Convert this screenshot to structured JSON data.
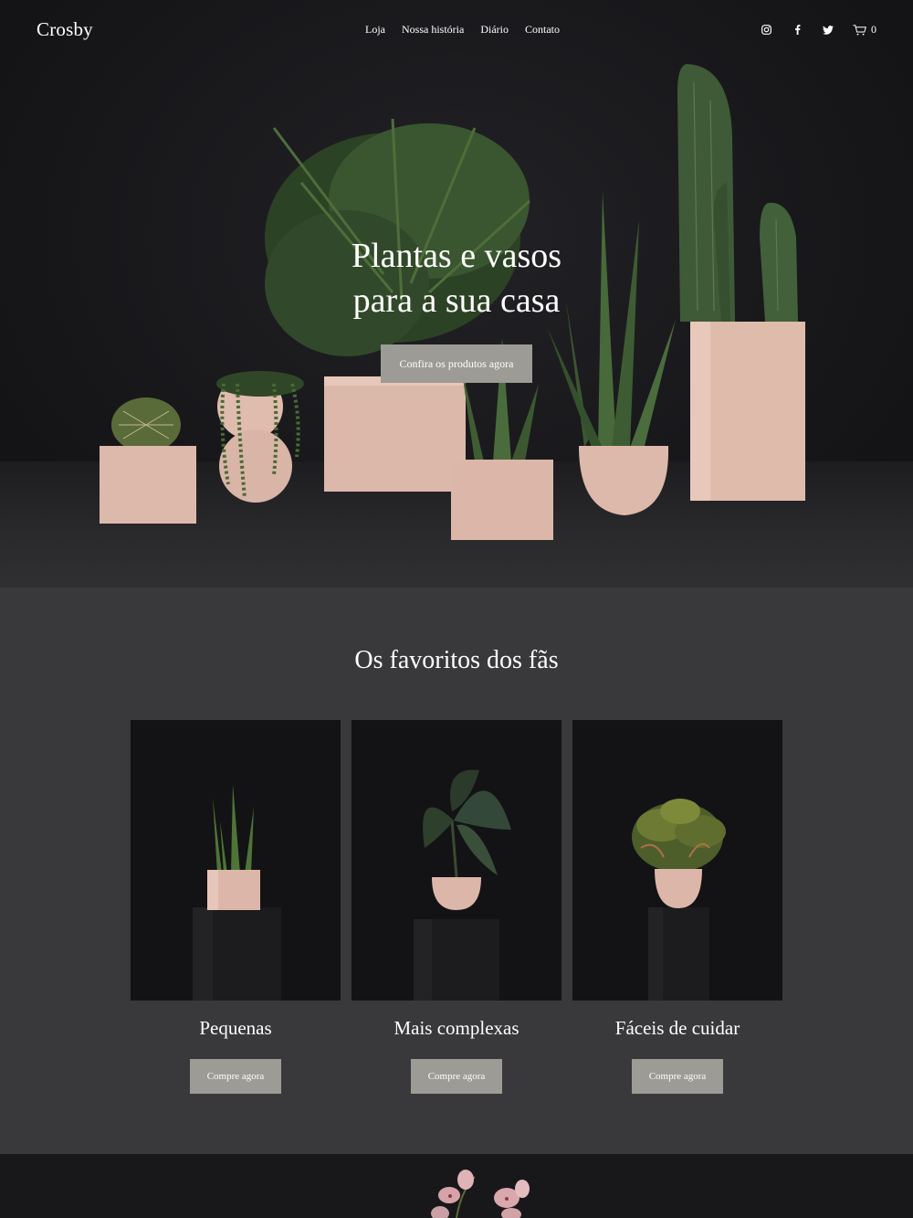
{
  "site": {
    "logo": "Crosby"
  },
  "nav": {
    "items": [
      {
        "label": "Loja"
      },
      {
        "label": "Nossa história"
      },
      {
        "label": "Diário"
      },
      {
        "label": "Contato"
      }
    ],
    "social_icons": [
      "instagram-icon",
      "facebook-icon",
      "twitter-icon"
    ],
    "cart_count": "0"
  },
  "hero": {
    "title_line1": "Plantas e vasos",
    "title_line2": "para a sua casa",
    "cta_label": "Confira os produtos agora"
  },
  "favorites": {
    "heading": "Os favoritos dos fãs",
    "cards": [
      {
        "title": "Pequenas",
        "button": "Compre agora"
      },
      {
        "title": "Mais complexas",
        "button": "Compre agora"
      },
      {
        "title": "Fáceis de cuidar",
        "button": "Compre agora"
      }
    ]
  },
  "colors": {
    "hero_bg": "#18181b",
    "section_bg": "#39393c",
    "button_bg": "#9c9b96",
    "pot_pink": "#e0bcae"
  }
}
